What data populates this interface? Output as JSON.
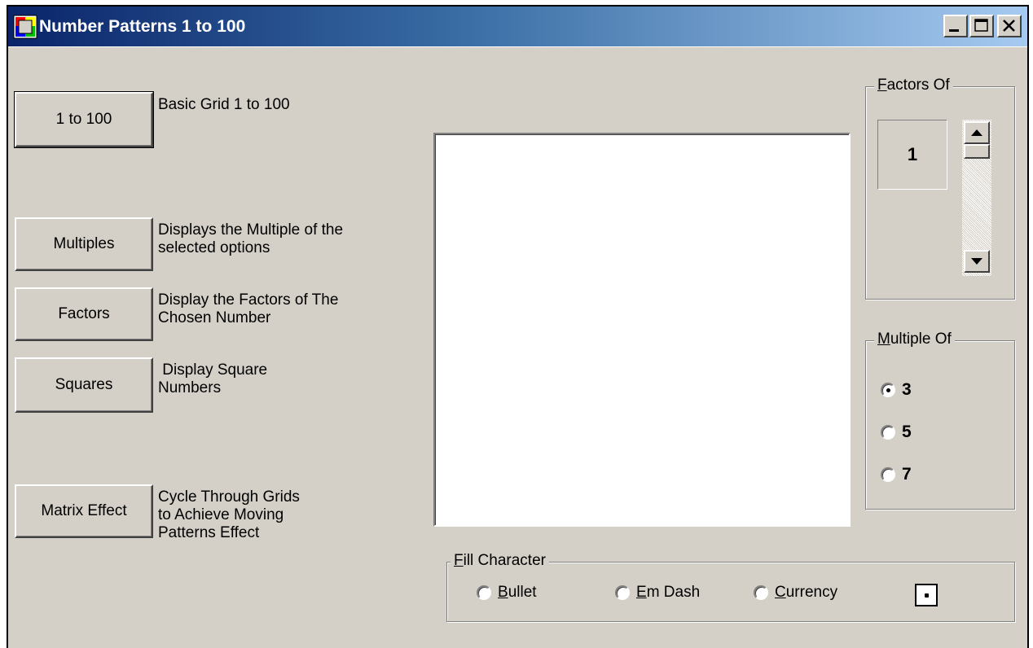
{
  "window": {
    "title": "Number Patterns 1 to 100"
  },
  "caption_buttons": {
    "minimize": "minimize",
    "maximize": "maximize",
    "close": "close"
  },
  "buttons": [
    {
      "label": "1 to 100",
      "description": "Basic Grid 1 to 100"
    },
    {
      "label": "Multiples",
      "description": "Displays the Multiple of the\nselected options"
    },
    {
      "label": "Factors",
      "description": "Display the Factors of The\nChosen Number"
    },
    {
      "label": "Squares",
      "description": " Display Square\nNumbers"
    },
    {
      "label": "Matrix Effect",
      "description": "Cycle Through Grids\nto Achieve Moving\nPatterns Effect"
    }
  ],
  "factors_of": {
    "label": "Factors Of",
    "access_key": "F",
    "label_rest": "actors Of",
    "value": "1",
    "scroll_position_fraction": 0.0
  },
  "multiple_of": {
    "label": "Multiple Of",
    "access_key": "M",
    "label_rest": "ultiple Of",
    "options": [
      {
        "label": "3",
        "checked": true
      },
      {
        "label": "5",
        "checked": false
      },
      {
        "label": "7",
        "checked": false
      }
    ]
  },
  "fill_character": {
    "label": "Fill Character",
    "access_key": "F",
    "label_rest": "ill Character",
    "options": [
      {
        "label": "Bullet",
        "access_key": "B",
        "label_rest": "ullet",
        "checked": false
      },
      {
        "label": "Em Dash",
        "access_key": "E",
        "label_rest": "m Dash",
        "checked": false
      },
      {
        "label": "Currency",
        "access_key": "C",
        "label_rest": "urrency",
        "checked": false
      }
    ],
    "selected_symbol": "•"
  }
}
